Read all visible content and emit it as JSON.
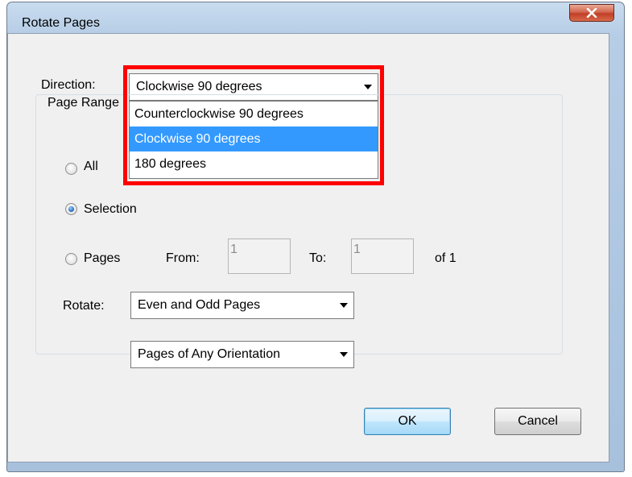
{
  "window": {
    "title": "Rotate Pages",
    "close_glyph": "X"
  },
  "direction": {
    "label": "Direction:",
    "selected": "Clockwise 90 degrees",
    "options": [
      "Counterclockwise 90 degrees",
      "Clockwise 90 degrees",
      "180 degrees"
    ],
    "highlighted_index": 1
  },
  "page_range": {
    "title": "Page Range",
    "all_label": "All",
    "selection_label": "Selection",
    "pages_label": "Pages",
    "from_label": "From:",
    "from_value": "1",
    "to_label": "To:",
    "to_value": "1",
    "of_label": "of 1",
    "selected_option": "Selection",
    "rotate_label": "Rotate:",
    "rotate_filter": "Even and Odd Pages",
    "orientation_filter": "Pages of Any Orientation"
  },
  "buttons": {
    "ok": "OK",
    "cancel": "Cancel"
  },
  "colors": {
    "highlight_box": "#ff0000",
    "selection_bg": "#3399ff"
  }
}
